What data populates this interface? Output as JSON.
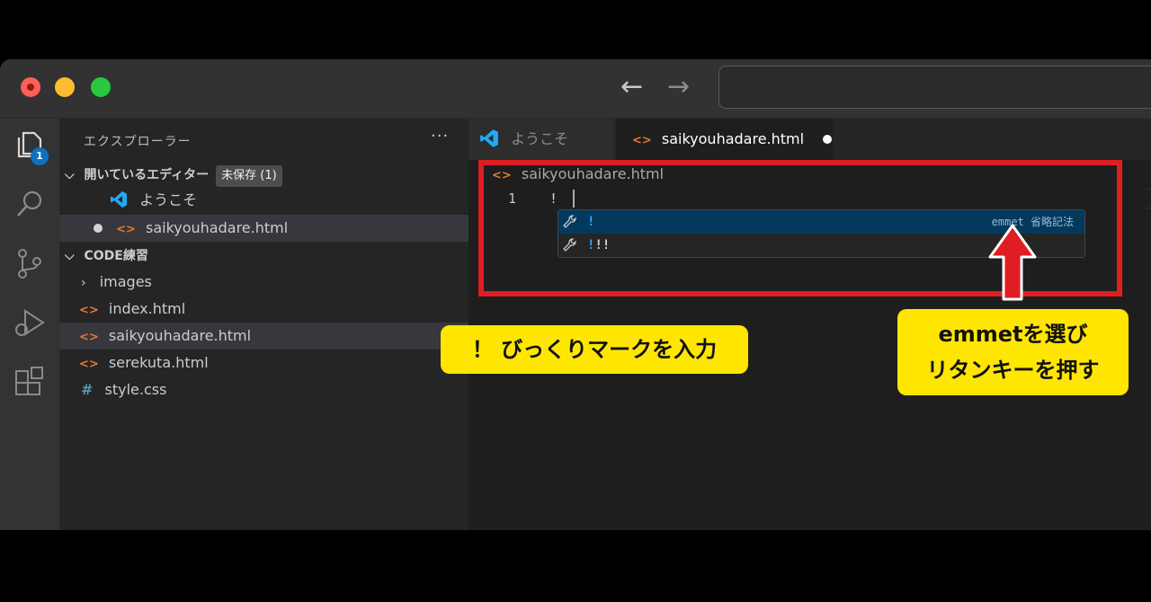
{
  "window": {
    "nav": {
      "back_icon": "arrow-left-icon",
      "forward_icon": "arrow-right-icon"
    }
  },
  "activity_bar": {
    "items": [
      "files-icon",
      "search-icon",
      "source-control-icon",
      "run-debug-icon",
      "extensions-icon"
    ],
    "explorer_badge": "1"
  },
  "sidebar": {
    "title": "エクスプローラー",
    "more": "···",
    "open_editors": {
      "label": "開いているエディター",
      "unsaved_badge": "未保存 (1)",
      "items": [
        "ようこそ",
        "saikyouhadare.html"
      ]
    },
    "project": {
      "label": "CODE練習",
      "items": [
        {
          "name": "images",
          "type": "folder"
        },
        {
          "name": "index.html",
          "type": "html"
        },
        {
          "name": "saikyouhadare.html",
          "type": "html"
        },
        {
          "name": "serekuta.html",
          "type": "html"
        },
        {
          "name": "style.css",
          "type": "css"
        }
      ]
    }
  },
  "editor": {
    "tabs": [
      {
        "label": "ようこそ",
        "active": false
      },
      {
        "label": "saikyouhadare.html",
        "active": true
      }
    ],
    "breadcrumb": "saikyouhadare.html",
    "line_number": "1",
    "code": "!",
    "suggestions": [
      {
        "label": "!",
        "detail": "emmet 省略記法",
        "selected": true
      },
      {
        "label": "!!!",
        "detail": "",
        "selected": false
      }
    ]
  },
  "annotations": {
    "callout_one": "！ びっくりマークを入力",
    "callout_two_line1": "emmetを選び",
    "callout_two_line2": "リタンキーを押す",
    "highlight_color": "#e11d24",
    "callout_color": "#ffe600"
  }
}
